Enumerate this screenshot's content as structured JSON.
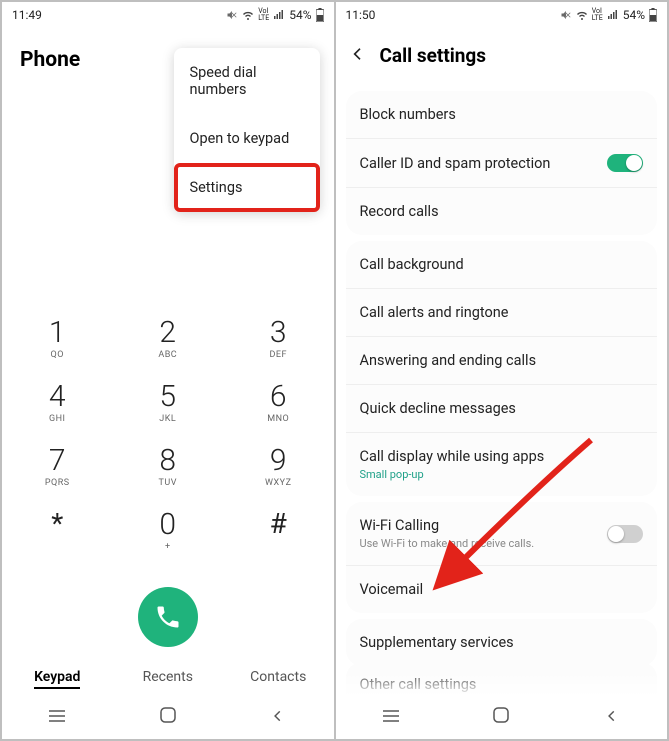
{
  "left": {
    "status": {
      "time": "11:49",
      "battery": "54%"
    },
    "title": "Phone",
    "menu": [
      "Speed dial numbers",
      "Open to keypad",
      "Settings"
    ],
    "keypad": [
      [
        {
          "n": "1",
          "s": "QO"
        },
        {
          "n": "2",
          "s": "ABC"
        },
        {
          "n": "3",
          "s": "DEF"
        }
      ],
      [
        {
          "n": "4",
          "s": "GHI"
        },
        {
          "n": "5",
          "s": "JKL"
        },
        {
          "n": "6",
          "s": "MNO"
        }
      ],
      [
        {
          "n": "7",
          "s": "PQRS"
        },
        {
          "n": "8",
          "s": "TUV"
        },
        {
          "n": "9",
          "s": "WXYZ"
        }
      ],
      [
        {
          "n": "*",
          "s": ""
        },
        {
          "n": "0",
          "s": "+"
        },
        {
          "n": "#",
          "s": ""
        }
      ]
    ],
    "tabs": [
      "Keypad",
      "Recents",
      "Contacts"
    ],
    "active_tab": 0
  },
  "right": {
    "status": {
      "time": "11:50",
      "battery": "54%"
    },
    "title": "Call settings",
    "sections": [
      [
        {
          "label": "Block numbers"
        },
        {
          "label": "Caller ID and spam protection",
          "toggle": true,
          "on": true
        },
        {
          "label": "Record calls"
        }
      ],
      [
        {
          "label": "Call background"
        },
        {
          "label": "Call alerts and ringtone"
        },
        {
          "label": "Answering and ending calls"
        },
        {
          "label": "Quick decline messages"
        },
        {
          "label": "Call display while using apps",
          "sub": "Small pop-up",
          "subGreen": true
        }
      ],
      [
        {
          "label": "Wi-Fi Calling",
          "sub": "Use Wi-Fi to make and receive calls.",
          "toggle": true,
          "on": false
        },
        {
          "label": "Voicemail"
        }
      ],
      [
        {
          "label": "Supplementary services"
        }
      ]
    ],
    "cut_label": "Other call settings"
  }
}
